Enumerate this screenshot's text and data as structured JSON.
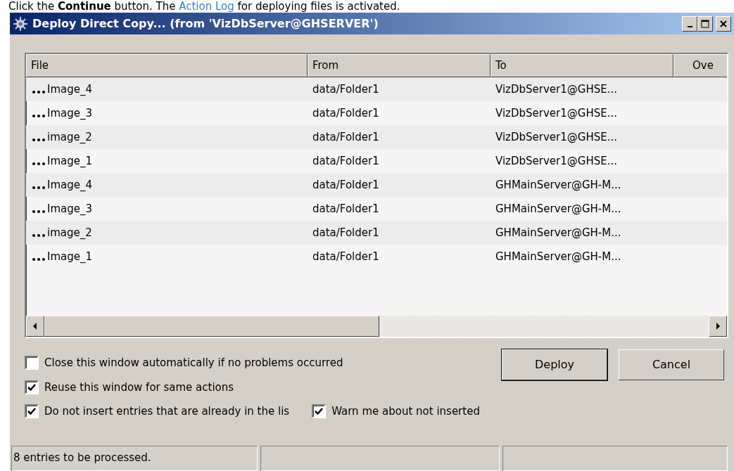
{
  "caption": {
    "before": "Click the ",
    "bold": "Continue",
    "middle": " button. The ",
    "link": "Action Log",
    "after": " for deploying files is activated."
  },
  "window": {
    "title": "Deploy Direct Copy... (from 'VizDbServer@GHSERVER')"
  },
  "table": {
    "columns": [
      "File",
      "From",
      "To",
      "Ove"
    ],
    "rows": [
      {
        "file": "Image_4",
        "from": "data/Folder1",
        "to": "VizDbServer1@GHSE..."
      },
      {
        "file": "Image_3",
        "from": "data/Folder1",
        "to": "VizDbServer1@GHSE..."
      },
      {
        "file": "image_2",
        "from": "data/Folder1",
        "to": "VizDbServer1@GHSE..."
      },
      {
        "file": "Image_1",
        "from": "data/Folder1",
        "to": "VizDbServer1@GHSE..."
      },
      {
        "file": "Image_4",
        "from": "data/Folder1",
        "to": "GHMainServer@GH-M..."
      },
      {
        "file": "Image_3",
        "from": "data/Folder1",
        "to": "GHMainServer@GH-M..."
      },
      {
        "file": "image_2",
        "from": "data/Folder1",
        "to": "GHMainServer@GH-M..."
      },
      {
        "file": "Image_1",
        "from": "data/Folder1",
        "to": "GHMainServer@GH-M..."
      }
    ]
  },
  "options": [
    {
      "label": "Close this window automatically if no problems occurred",
      "checked": false
    },
    {
      "label": "Reuse this window for same actions",
      "checked": true
    },
    {
      "label": "Do not insert entries that are already in the lis",
      "checked": true
    },
    {
      "label": "Warn me about not inserted",
      "checked": true
    }
  ],
  "buttons": [
    "Deploy",
    "Cancel"
  ],
  "status_bar": "8 entries to be processed."
}
